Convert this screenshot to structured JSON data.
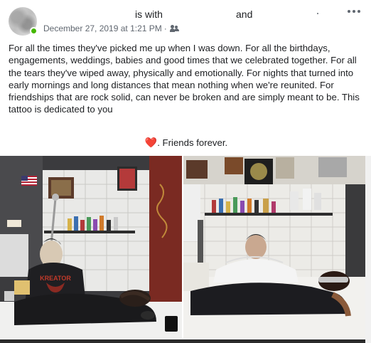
{
  "post": {
    "header": {
      "is_with": "is with",
      "and": "and",
      "timestamp": "December 27, 2019 at 1:21 PM",
      "separator": "·",
      "privacy_icon": "friends-icon",
      "more_icon": "ellipsis-icon"
    },
    "body": "For all the times they've picked me up when I was down. For all the birthdays, engagements, weddings, babies and good times that we celebrated together. For all the tears they've wiped away, physically and emotionally. For nights that turned into early mornings and long distances that mean nothing when we're reunited. For friendships that are rock solid, can never be broken and are simply meant to be. This tattoo is dedicated to you",
    "closing_emoji": "❤️",
    "closing_text": ". Friends forever.",
    "photo_text": "KREATOR"
  },
  "colors": {
    "text": "#1c1e21",
    "secondary": "#606770",
    "online": "#44b700",
    "heart": "#e0245e"
  }
}
